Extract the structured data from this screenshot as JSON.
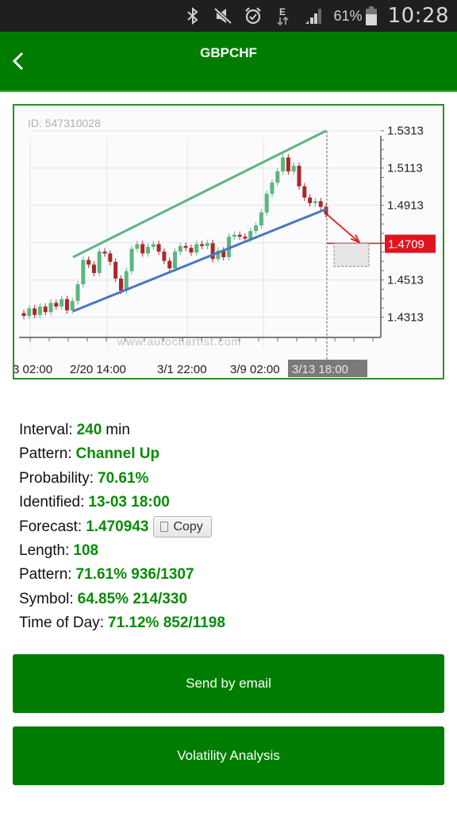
{
  "status_bar": {
    "icons": [
      "bluetooth-icon",
      "mute-icon",
      "alarm-icon",
      "data-e-icon",
      "signal-icon",
      "battery-icon"
    ],
    "battery_percent": "61%",
    "time": "10:28"
  },
  "app_bar": {
    "title": "GBPCHF",
    "back_icon": "chevron-left-icon"
  },
  "colors": {
    "brand_green": "#007d00",
    "value_green": "#0a8a0a",
    "bull_candle": "#5cb67e",
    "bear_candle": "#a8282a",
    "channel_upper": "#5cb67e",
    "channel_lower": "#4a78c0",
    "forecast": "#e02020"
  },
  "chart_data": {
    "type": "candlestick",
    "id_label": "ID: 547310028",
    "watermark": "www.autochartist.com",
    "yticks": [
      "1.5313",
      "1.5113",
      "1.4913",
      "1.4513",
      "1.4313"
    ],
    "ylim": [
      1.4213,
      1.5363
    ],
    "xticks": [
      "3 02:00",
      "2/20 14:00",
      "3/1 22:00",
      "3/9 02:00"
    ],
    "identified_marker": "3/13 18:00",
    "forecast_label": "1.4709",
    "forecast_value": 1.4709,
    "forecast_range": [
      1.4709,
      1.4585
    ],
    "channel_upper": {
      "start": [
        0.12,
        1.4635
      ],
      "end": [
        0.7,
        1.5313
      ]
    },
    "channel_lower": {
      "start": [
        0.12,
        1.4345
      ],
      "end": [
        0.7,
        1.4893
      ]
    },
    "price_path": [
      1.4335,
      1.432,
      1.436,
      1.4325,
      1.437,
      1.434,
      1.439,
      1.437,
      1.441,
      1.435,
      1.44,
      1.449,
      1.462,
      1.4595,
      1.455,
      1.4665,
      1.4655,
      1.461,
      1.452,
      1.4455,
      1.456,
      1.468,
      1.4705,
      1.4655,
      1.469,
      1.4705,
      1.4665,
      1.4615,
      1.4575,
      1.4665,
      1.4695,
      1.4685,
      1.466,
      1.4705,
      1.4695,
      1.471,
      1.4625,
      1.467,
      1.4635,
      1.4745,
      1.4755,
      1.4745,
      1.4735,
      1.4775,
      1.4805,
      1.4875,
      1.4975,
      1.5035,
      1.5095,
      1.517,
      1.5095,
      1.5125,
      1.5015,
      1.4955,
      1.4925,
      1.4935,
      1.4905,
      1.4865
    ]
  },
  "details": {
    "interval": {
      "label": "Interval:",
      "value": "240",
      "unit": "min"
    },
    "pattern_name": {
      "label": "Pattern:",
      "value": "Channel Up"
    },
    "probability": {
      "label": "Probability:",
      "value": "70.61%"
    },
    "identified": {
      "label": "Identified:",
      "value": "13-03 18:00"
    },
    "forecast": {
      "label": "Forecast:",
      "value": "1.470943",
      "copy_label": "Copy"
    },
    "length": {
      "label": "Length:",
      "value": "108"
    },
    "pattern_stats": {
      "label": "Pattern:",
      "value": "71.61% 936/1307"
    },
    "symbol": {
      "label": "Symbol:",
      "value": "64.85% 214/330"
    },
    "time_of_day": {
      "label": "Time of Day:",
      "value": "71.12% 852/1198"
    }
  },
  "buttons": {
    "send_email": "Send by email",
    "volatility": "Volatility Analysis"
  }
}
